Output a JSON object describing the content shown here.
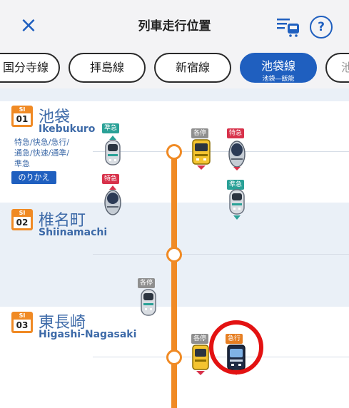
{
  "header": {
    "title": "列車走行位置",
    "close_icon": "×",
    "help_icon": "?"
  },
  "tabs": [
    {
      "label": "国分寺線",
      "visible_label": "国分寺線",
      "active": false
    },
    {
      "label": "拝島線",
      "active": false
    },
    {
      "label": "新宿線",
      "active": false
    },
    {
      "label": "池袋線",
      "sub": "池袋―飯能",
      "active": true
    },
    {
      "label": "池",
      "active": false
    }
  ],
  "stations": [
    {
      "code": "SI",
      "num": "01",
      "name_ja": "池袋",
      "name_en": "Ikebukuro",
      "note": "特急/快急/急行/\n通急/快速/通準/\n準急",
      "transfer": "のりかえ"
    },
    {
      "code": "SI",
      "num": "02",
      "name_ja": "椎名町",
      "name_en": "Shiinamachi"
    },
    {
      "code": "SI",
      "num": "03",
      "name_ja": "東長崎",
      "name_en": "Higashi-Nagasaki"
    }
  ],
  "trains": [
    {
      "type": "準急",
      "color": "#2aa197",
      "body": "silver"
    },
    {
      "type": "各停",
      "color": "#8f8f8f",
      "body": "yellow"
    },
    {
      "type": "特急",
      "color": "#d8324b",
      "body": "laview"
    },
    {
      "type": "特急",
      "color": "#d8324b",
      "body": "laview"
    },
    {
      "type": "準急",
      "color": "#2aa197",
      "body": "silver"
    },
    {
      "type": "各停",
      "color": "#8f8f8f",
      "body": "silver"
    },
    {
      "type": "各停",
      "color": "#8f8f8f",
      "body": "yellow"
    },
    {
      "type": "急行",
      "color": "#e67e22",
      "body": "dark"
    }
  ],
  "colors": {
    "accent": "#1f5fbf",
    "line": "#f08a24",
    "band": "#eaf0f7",
    "highlight": "#e31212"
  }
}
